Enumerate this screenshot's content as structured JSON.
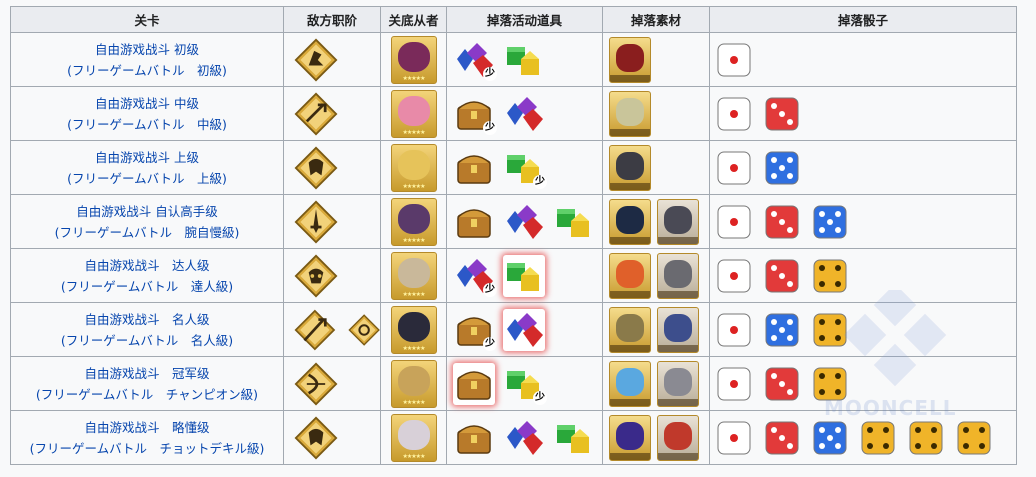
{
  "headers": {
    "stage": "关卡",
    "enemy_class": "敌方职阶",
    "servant": "关底从者",
    "event_items": "掉落活动道具",
    "materials": "掉落素材",
    "dice": "掉落骰子"
  },
  "few_label": "少",
  "watermark": "MOONCELL",
  "colors": {
    "link": "#0645ad",
    "header_bg": "#eaecf0",
    "border": "#a2a9b1",
    "die_white": "#ffffff",
    "die_red": "#e23a3a",
    "die_blue": "#2f6fe0",
    "die_gold": "#f0b429"
  },
  "rows": [
    {
      "name": "自由游戏战斗 初级",
      "jp": "(フリーゲームバトル　初級)",
      "classes": [
        "rider-icon"
      ],
      "servant_color": "#7a2a5a",
      "items": [
        {
          "type": "gem",
          "few": true
        },
        {
          "type": "block",
          "few": false
        }
      ],
      "materials": [
        "#8a1e1e"
      ],
      "dice": [
        "white"
      ]
    },
    {
      "name": "自由游戏战斗 中级",
      "jp": "(フリーゲームバトル　中級)",
      "classes": [
        "caster-icon"
      ],
      "servant_color": "#e88aa8",
      "items": [
        {
          "type": "chest",
          "few": true
        },
        {
          "type": "gem",
          "few": false
        }
      ],
      "materials": [
        "#c9c59a"
      ],
      "dice": [
        "white",
        "red"
      ]
    },
    {
      "name": "自由游戏战斗 上级",
      "jp": "(フリーゲームバトル　上級)",
      "classes": [
        "berserker-icon"
      ],
      "servant_color": "#e6c35a",
      "items": [
        {
          "type": "chest",
          "few": false
        },
        {
          "type": "block",
          "few": true
        }
      ],
      "materials": [
        "#3c3c44"
      ],
      "dice": [
        "white",
        "blue"
      ]
    },
    {
      "name": "自由游戏战斗 自认高手级",
      "jp": "(フリーゲームバトル　腕自慢級)",
      "classes": [
        "saber-icon"
      ],
      "servant_color": "#5a3a6a",
      "items": [
        {
          "type": "chest",
          "few": false
        },
        {
          "type": "gem",
          "few": false
        },
        {
          "type": "block",
          "few": false
        }
      ],
      "materials": [
        "#1d2a44",
        "#4a4a55"
      ],
      "dice": [
        "white",
        "red",
        "blue"
      ]
    },
    {
      "name": "自由游戏战斗　达人级",
      "jp": "(フリーゲームバトル　達人級)",
      "classes": [
        "assassin-icon"
      ],
      "servant_color": "#c9b89a",
      "items": [
        {
          "type": "gem",
          "few": true
        },
        {
          "type": "block",
          "few": false,
          "hl": true
        }
      ],
      "materials": [
        "#e0602a",
        "#6a6a70"
      ],
      "dice": [
        "white",
        "red",
        "gold"
      ]
    },
    {
      "name": "自由游戏战斗　名人级",
      "jp": "(フリーゲームバトル　名人級)",
      "classes": [
        "lancer-icon",
        "caster-icon-small"
      ],
      "servant_color": "#2a2a3a",
      "items": [
        {
          "type": "chest",
          "few": true
        },
        {
          "type": "gem",
          "few": false,
          "hl": true
        }
      ],
      "materials": [
        "#8a7a4a",
        "#3d4e8c"
      ],
      "dice": [
        "white",
        "blue",
        "gold"
      ]
    },
    {
      "name": "自由游戏战斗　冠军级",
      "jp": "(フリーゲームバトル　チャンピオン級)",
      "classes": [
        "archer-icon"
      ],
      "servant_color": "#c8a35a",
      "items": [
        {
          "type": "chest",
          "few": false,
          "hl": true
        },
        {
          "type": "block",
          "few": true
        }
      ],
      "materials": [
        "#5aa8e0",
        "#8a8a92"
      ],
      "dice": [
        "white",
        "red",
        "gold"
      ]
    },
    {
      "name": "自由游戏战斗　略懂级",
      "jp": "(フリーゲームバトル　チョットデキル級)",
      "classes": [
        "berserker-icon"
      ],
      "servant_color": "#d8d0d8",
      "items": [
        {
          "type": "chest",
          "few": false
        },
        {
          "type": "gem",
          "few": false
        },
        {
          "type": "block",
          "few": false
        }
      ],
      "materials": [
        "#3a2a8a",
        "#c0392b"
      ],
      "dice": [
        "white",
        "red",
        "blue",
        "gold",
        "gold",
        "gold"
      ]
    }
  ]
}
